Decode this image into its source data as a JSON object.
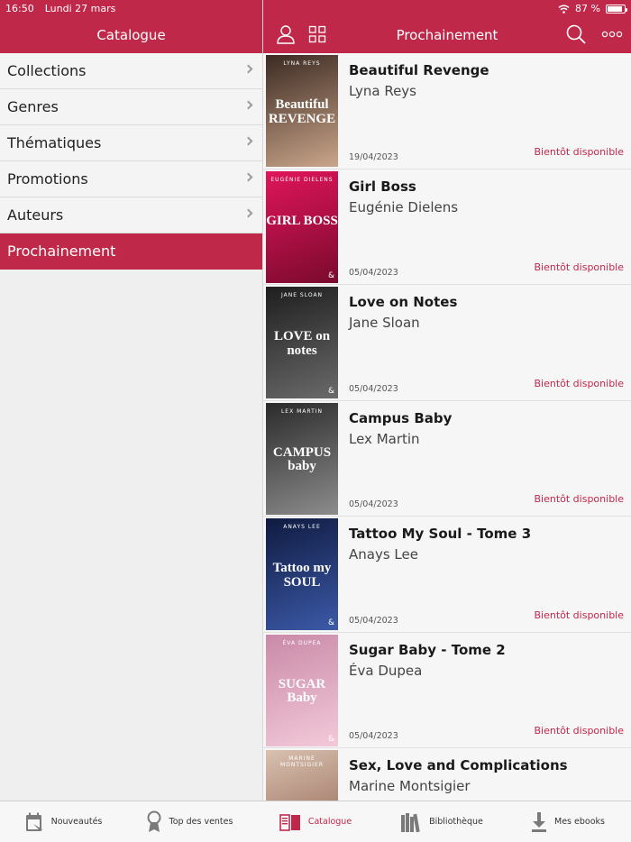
{
  "status_bar": {
    "time": "16:50",
    "date": "Lundi 27 mars",
    "battery": "87 %",
    "battery_level": 0.87
  },
  "left_header": {
    "title": "Catalogue"
  },
  "right_header": {
    "title": "Prochainement",
    "icons": [
      "user-icon",
      "grid-icon",
      "search-icon",
      "more-icon"
    ]
  },
  "sidebar": {
    "items": [
      {
        "label": "Collections"
      },
      {
        "label": "Genres"
      },
      {
        "label": "Thématiques"
      },
      {
        "label": "Promotions"
      },
      {
        "label": "Auteurs"
      },
      {
        "label": "Prochainement"
      }
    ],
    "active": "Prochainement"
  },
  "books": [
    {
      "title": "Beautiful Revenge",
      "author": "Lyna Reys",
      "date": "19/04/2023",
      "status": "Bientôt disponible",
      "cover_title": "Beautiful REVENGE",
      "cover_author": "LYNA REYS",
      "cover_colors": [
        "#3b2a22",
        "#caa58a"
      ]
    },
    {
      "title": "Girl Boss",
      "author": "Eugénie Dielens",
      "date": "05/04/2023",
      "status": "Bientôt disponible",
      "cover_title": "GIRL BOSS",
      "cover_author": "EUGÉNIE DIELENS",
      "cover_colors": [
        "#e0155a",
        "#7a0a2e"
      ]
    },
    {
      "title": "Love on Notes",
      "author": "Jane Sloan",
      "date": "05/04/2023",
      "status": "Bientôt disponible",
      "cover_title": "LOVE on notes",
      "cover_author": "JANE SLOAN",
      "cover_colors": [
        "#1e1e1e",
        "#6a6a6a"
      ]
    },
    {
      "title": "Campus Baby",
      "author": "Lex Martin",
      "date": "05/04/2023",
      "status": "Bientôt disponible",
      "cover_title": "CAMPUS baby",
      "cover_author": "LEX MARTIN",
      "cover_colors": [
        "#2b2b2b",
        "#8c8c8c"
      ]
    },
    {
      "title": "Tattoo My Soul - Tome 3",
      "author": "Anays Lee",
      "date": "05/04/2023",
      "status": "Bientôt disponible",
      "cover_title": "Tattoo my SOUL",
      "cover_author": "ANAYS LEE",
      "cover_colors": [
        "#0f1a40",
        "#3c5aa8"
      ]
    },
    {
      "title": "Sugar Baby - Tome 2",
      "author": "Éva Dupea",
      "date": "05/04/2023",
      "status": "Bientôt disponible",
      "cover_title": "SUGAR Baby",
      "cover_author": "ÉVA DUPEA",
      "cover_colors": [
        "#c98aa8",
        "#f3c9d9"
      ]
    },
    {
      "title": "Sex, Love and Complications",
      "author": "Marine Montsigier",
      "date": "",
      "status": "",
      "cover_title": "",
      "cover_author": "MARINE MONTSIGIER",
      "cover_colors": [
        "#d9c1b0",
        "#8a5a48"
      ]
    }
  ],
  "tab_bar": {
    "tabs": [
      {
        "label": "Nouveautés",
        "icon": "calendar-icon"
      },
      {
        "label": "Top des ventes",
        "icon": "medal-icon"
      },
      {
        "label": "Catalogue",
        "icon": "book-icon",
        "active": true
      },
      {
        "label": "Bibliothèque",
        "icon": "library-icon"
      },
      {
        "label": "Mes ebooks",
        "icon": "download-icon"
      }
    ]
  },
  "colors": {
    "brand": "#c0284a",
    "background": "#f2f2f2"
  }
}
